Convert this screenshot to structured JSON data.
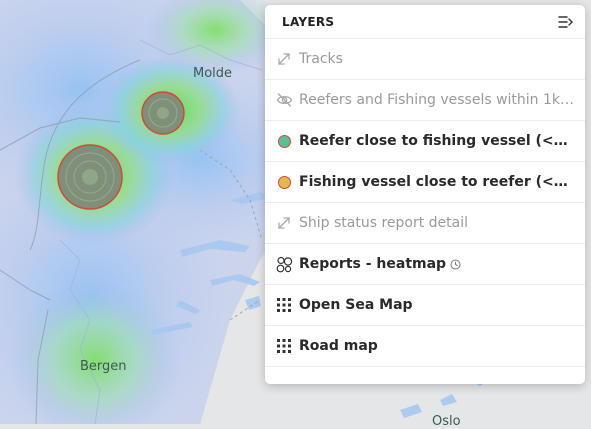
{
  "map": {
    "cities": {
      "molde": "Molde",
      "bergen": "Bergen",
      "oslo": "Oslo"
    },
    "colors": {
      "cluster_fill": "#7f8f7a",
      "cluster_stroke": "#d04a3a",
      "land": "#e4e6e8",
      "water": "#a8c8f0"
    }
  },
  "panel": {
    "title": "LAYERS",
    "collapse_icon": "collapse-panel-icon",
    "layers": [
      {
        "label": "Tracks",
        "state": "off",
        "icon": "expand-arrows-icon"
      },
      {
        "label": "Reefers and Fishing vessels within 1km ...",
        "state": "off",
        "icon": "eye-off-icon"
      },
      {
        "label": "Reefer close to fishing vessel (<500m, ...",
        "state": "on",
        "icon": "green-dot-icon",
        "dot_fill": "#5dbf93",
        "dot_stroke": "#c94a3c"
      },
      {
        "label": "Fishing vessel close to reefer (<500m, ...",
        "state": "on",
        "icon": "yellow-dot-icon",
        "dot_fill": "#e3b84e",
        "dot_stroke": "#c94a3c"
      },
      {
        "label": "Ship status report detail",
        "state": "off",
        "icon": "expand-arrows-icon"
      },
      {
        "label": "Reports - heatmap",
        "state": "on",
        "icon": "circles-icon",
        "has_clock": true
      },
      {
        "label": "Open Sea Map",
        "state": "on",
        "icon": "grid-icon"
      },
      {
        "label": "Road map",
        "state": "on",
        "icon": "grid-icon"
      }
    ]
  }
}
